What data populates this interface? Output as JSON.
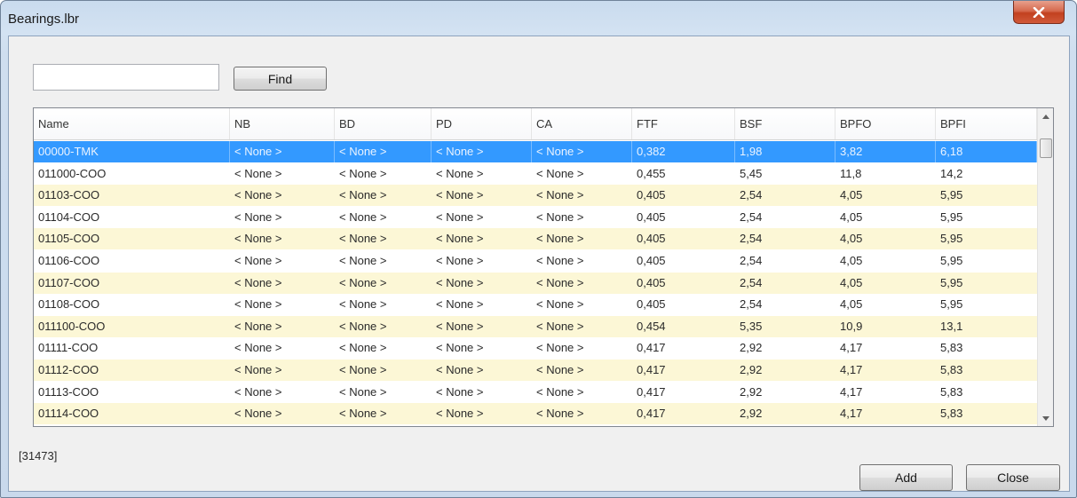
{
  "window": {
    "title": "Bearings.lbr"
  },
  "search": {
    "value": "",
    "placeholder": "",
    "find_label": "Find"
  },
  "table": {
    "columns": [
      "Name",
      "NB",
      "BD",
      "PD",
      "CA",
      "FTF",
      "BSF",
      "BPFO",
      "BPFI"
    ],
    "selected_row": 0,
    "rows": [
      [
        "00000-TMK",
        "< None >",
        "< None >",
        "< None >",
        "< None >",
        "0,382",
        "1,98",
        "3,82",
        "6,18"
      ],
      [
        "011000-COO",
        "< None >",
        "< None >",
        "< None >",
        "< None >",
        "0,455",
        "5,45",
        "11,8",
        "14,2"
      ],
      [
        "01103-COO",
        "< None >",
        "< None >",
        "< None >",
        "< None >",
        "0,405",
        "2,54",
        "4,05",
        "5,95"
      ],
      [
        "01104-COO",
        "< None >",
        "< None >",
        "< None >",
        "< None >",
        "0,405",
        "2,54",
        "4,05",
        "5,95"
      ],
      [
        "01105-COO",
        "< None >",
        "< None >",
        "< None >",
        "< None >",
        "0,405",
        "2,54",
        "4,05",
        "5,95"
      ],
      [
        "01106-COO",
        "< None >",
        "< None >",
        "< None >",
        "< None >",
        "0,405",
        "2,54",
        "4,05",
        "5,95"
      ],
      [
        "01107-COO",
        "< None >",
        "< None >",
        "< None >",
        "< None >",
        "0,405",
        "2,54",
        "4,05",
        "5,95"
      ],
      [
        "01108-COO",
        "< None >",
        "< None >",
        "< None >",
        "< None >",
        "0,405",
        "2,54",
        "4,05",
        "5,95"
      ],
      [
        "011100-COO",
        "< None >",
        "< None >",
        "< None >",
        "< None >",
        "0,454",
        "5,35",
        "10,9",
        "13,1"
      ],
      [
        "01111-COO",
        "< None >",
        "< None >",
        "< None >",
        "< None >",
        "0,417",
        "2,92",
        "4,17",
        "5,83"
      ],
      [
        "01112-COO",
        "< None >",
        "< None >",
        "< None >",
        "< None >",
        "0,417",
        "2,92",
        "4,17",
        "5,83"
      ],
      [
        "01113-COO",
        "< None >",
        "< None >",
        "< None >",
        "< None >",
        "0,417",
        "2,92",
        "4,17",
        "5,83"
      ],
      [
        "01114-COO",
        "< None >",
        "< None >",
        "< None >",
        "< None >",
        "0,417",
        "2,92",
        "4,17",
        "5,83"
      ]
    ]
  },
  "status": {
    "count": "[31473]"
  },
  "buttons": {
    "add_label": "Add",
    "close_label": "Close"
  },
  "icons": {
    "window_close": "close-icon",
    "scroll_up": "scroll-up-arrow-icon",
    "scroll_down": "scroll-down-arrow-icon"
  },
  "colors": {
    "selection": "#3399ff",
    "row_alternate": "#fcf7d6",
    "close_button": "#c74b2b"
  }
}
